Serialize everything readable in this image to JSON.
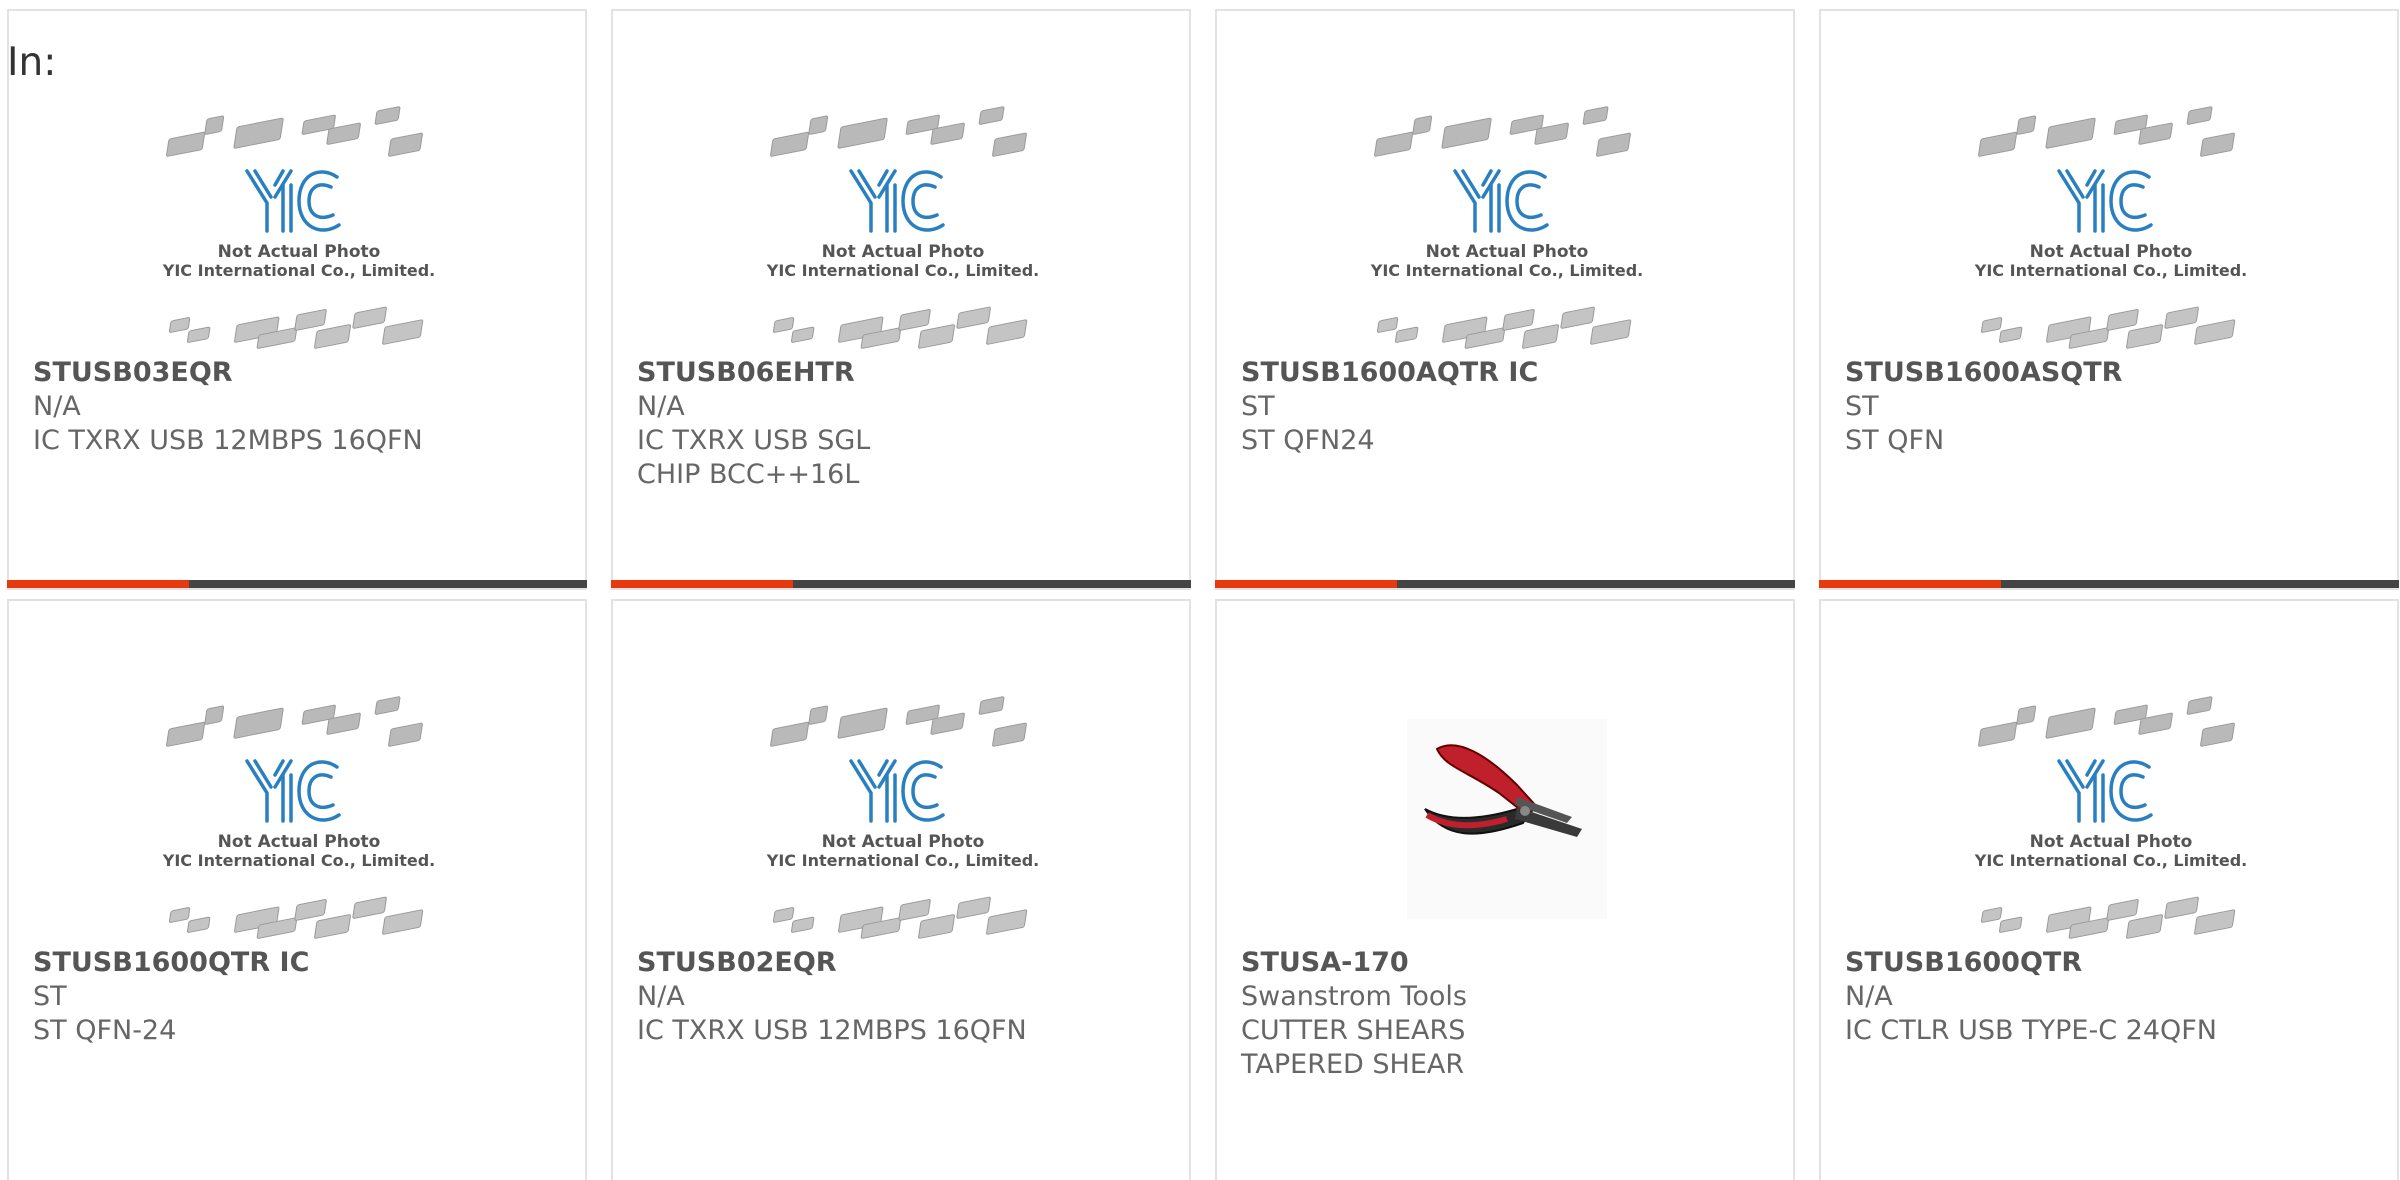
{
  "header": {
    "label": "In:"
  },
  "placeholder": {
    "logo_text": "YIC",
    "caption_line1": "Not Actual Photo",
    "caption_line2": "YIC International Co., Limited."
  },
  "colors": {
    "accent": "#e8380d",
    "bar_dark": "#444444",
    "logo_blue": "#2a7fc0",
    "card_border": "#e2e2e2"
  },
  "products": [
    {
      "part_number": "STUSB03EQR",
      "manufacturer": "N/A",
      "description": "IC TXRX USB 12MBPS 16QFN",
      "image": "yic-placeholder"
    },
    {
      "part_number": "STUSB06EHTR",
      "manufacturer": "N/A",
      "description": "IC TXRX USB SGL CHIP BCC++16L",
      "image": "yic-placeholder"
    },
    {
      "part_number": "STUSB1600AQTR IC",
      "manufacturer": "ST",
      "description": "ST QFN24",
      "image": "yic-placeholder"
    },
    {
      "part_number": "STUSB1600ASQTR",
      "manufacturer": "ST",
      "description": "ST QFN",
      "image": "yic-placeholder"
    },
    {
      "part_number": "STUSB1600QTR IC",
      "manufacturer": "ST",
      "description": "ST QFN-24",
      "image": "yic-placeholder"
    },
    {
      "part_number": "STUSB02EQR",
      "manufacturer": "N/A",
      "description": "IC TXRX USB 12MBPS 16QFN",
      "image": "yic-placeholder"
    },
    {
      "part_number": "STUSA-170",
      "manufacturer": "Swanstrom Tools",
      "description": "CUTTER SHEARS TAPERED SHEAR",
      "image": "cutter-photo"
    },
    {
      "part_number": "STUSB1600QTR",
      "manufacturer": "N/A",
      "description": "IC CTLR USB TYPE-C 24QFN",
      "image": "yic-placeholder"
    }
  ]
}
